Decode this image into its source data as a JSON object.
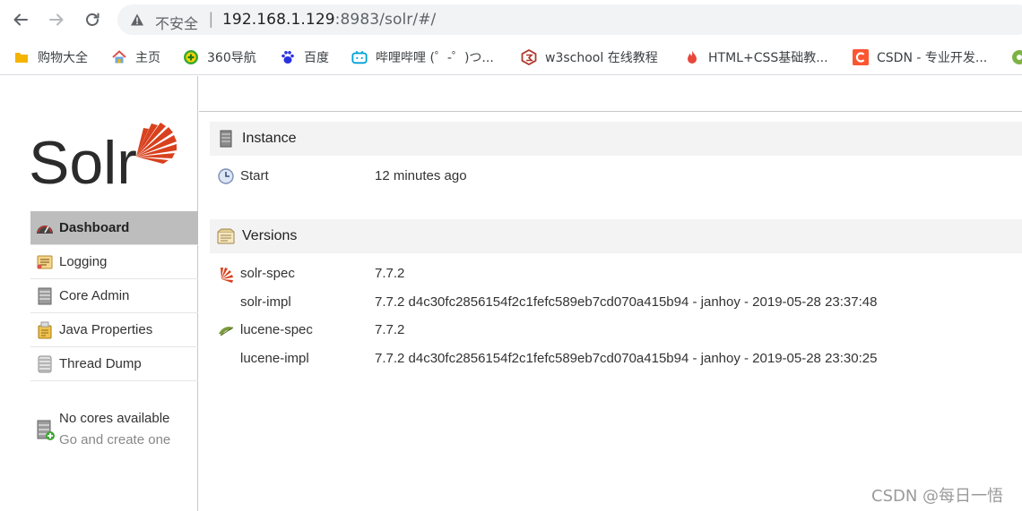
{
  "browser": {
    "insecure_label": "不安全",
    "separator": "|",
    "url_host": "192.168.1.129",
    "url_rest": ":8983/solr/#/",
    "bookmarks": [
      {
        "label": "购物大全",
        "icon": "folder-icon"
      },
      {
        "label": "主页",
        "icon": "home-icon"
      },
      {
        "label": "360导航",
        "icon": "360-icon"
      },
      {
        "label": "百度",
        "icon": "baidu-paw-icon"
      },
      {
        "label": "哔哩哔哩 (゜-゜)つ...",
        "icon": "bilibili-tv-icon"
      },
      {
        "label": "w3school 在线教程",
        "icon": "w3school-icon"
      },
      {
        "label": "HTML+CSS基础教...",
        "icon": "flame-icon"
      },
      {
        "label": "CSDN - 专业开发...",
        "icon": "csdn-c-icon"
      }
    ]
  },
  "solr": {
    "logo_text": "Solr",
    "nav": [
      {
        "label": "Dashboard",
        "icon": "dashboard-icon",
        "active": true
      },
      {
        "label": "Logging",
        "icon": "logging-icon",
        "active": false
      },
      {
        "label": "Core Admin",
        "icon": "core-admin-icon",
        "active": false
      },
      {
        "label": "Java Properties",
        "icon": "java-properties-icon",
        "active": false
      },
      {
        "label": "Thread Dump",
        "icon": "thread-dump-icon",
        "active": false
      }
    ],
    "no_cores": {
      "title": "No cores available",
      "link": "Go and create one"
    },
    "instance": {
      "heading": "Instance",
      "start_label": "Start",
      "start_value": "12 minutes ago"
    },
    "versions": {
      "heading": "Versions",
      "rows": [
        {
          "key": "solr-spec",
          "value": "7.7.2"
        },
        {
          "key": "solr-impl",
          "value": "7.7.2 d4c30fc2856154f2c1fefc589eb7cd070a415b94 - janhoy - 2019-05-28 23:37:48"
        },
        {
          "key": "lucene-spec",
          "value": "7.7.2"
        },
        {
          "key": "lucene-impl",
          "value": "7.7.2 d4c30fc2856154f2c1fefc589eb7cd070a415b94 - janhoy - 2019-05-28 23:30:25"
        }
      ]
    }
  },
  "watermark": "CSDN @每日一悟",
  "colors": {
    "solr_red": "#d9411e",
    "active_nav_bg": "#bdbdbd",
    "header_bg": "#f3f3f3"
  }
}
